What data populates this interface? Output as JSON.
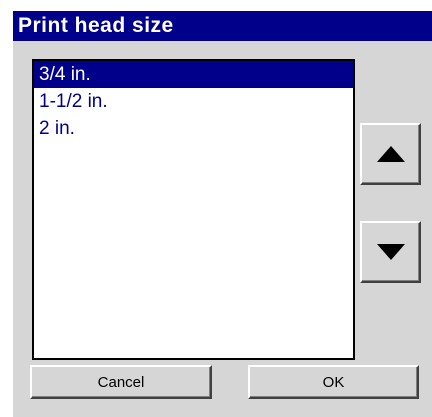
{
  "dialog": {
    "title": "Print head size"
  },
  "list": {
    "items": [
      {
        "label": "3/4 in.",
        "selected": true
      },
      {
        "label": "1-1/2 in.",
        "selected": false
      },
      {
        "label": "2 in.",
        "selected": false
      }
    ]
  },
  "buttons": {
    "up_icon": "triangle-up-icon",
    "down_icon": "triangle-down-icon",
    "cancel_label": "Cancel",
    "ok_label": "OK"
  },
  "colors": {
    "title_bg": "#00008b",
    "selection_bg": "#00008b",
    "item_text": "#00008b",
    "dialog_bg": "#d6d6d6"
  }
}
